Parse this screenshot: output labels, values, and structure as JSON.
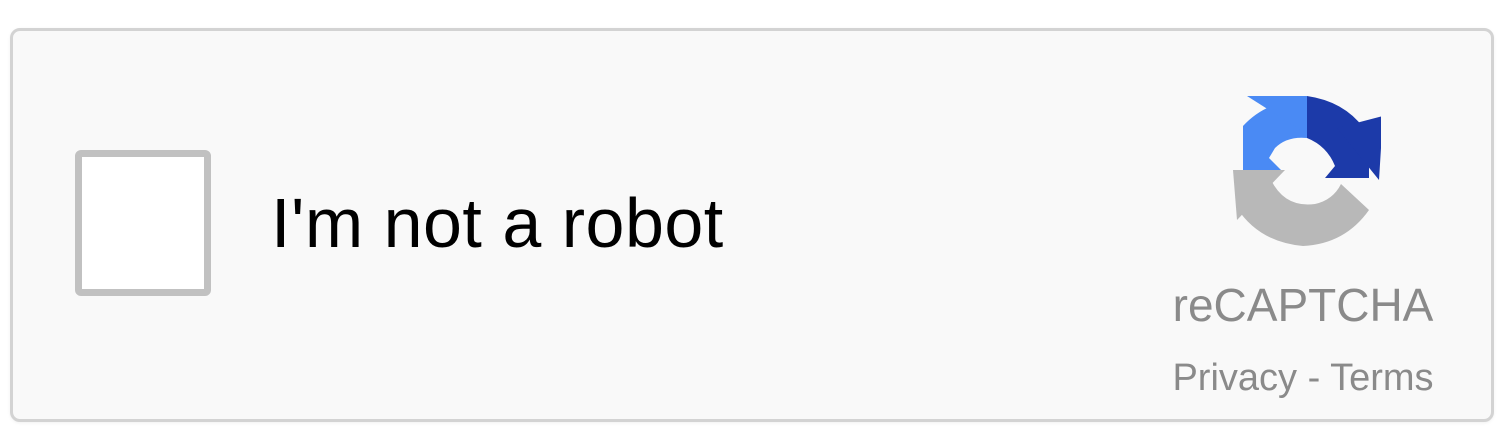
{
  "captcha": {
    "checkbox_label": "I'm not a robot",
    "checked": false,
    "brand_name": "reCAPTCHA",
    "privacy_link": "Privacy",
    "separator": " - ",
    "terms_link": "Terms",
    "logo_icon": "recaptcha-logo-icon"
  },
  "colors": {
    "logo_blue_light": "#4a8af4",
    "logo_blue_dark": "#1c3aa9",
    "logo_gray": "#b8b8b8",
    "text_gray": "#8a8a8a",
    "checkbox_border": "#c1c1c1",
    "widget_background": "#f9f9f9",
    "widget_border": "#d3d3d3"
  }
}
